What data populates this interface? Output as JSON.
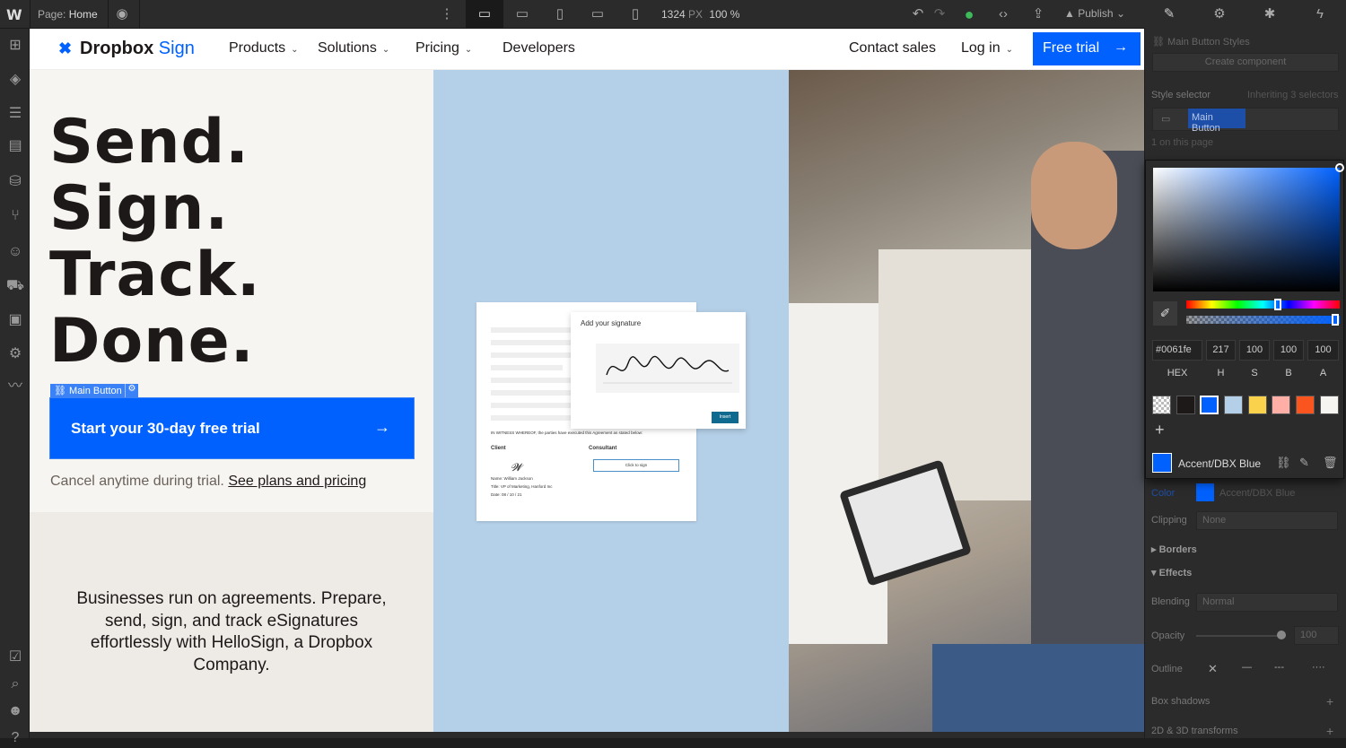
{
  "topbar": {
    "page_prefix": "Page:",
    "page_name": "Home",
    "width_value": "1324",
    "width_unit": "PX",
    "zoom": "100 %",
    "publish_label": "Publish"
  },
  "site": {
    "brand_word": "Dropbox",
    "brand_sign": "Sign",
    "nav": [
      "Products",
      "Solutions",
      "Pricing",
      "Developers"
    ],
    "contact_sales": "Contact sales",
    "log_in": "Log in",
    "free_trial": "Free trial",
    "headline": [
      "Send.",
      "Sign.",
      "Track.",
      "Done."
    ],
    "selected_tag": "Main Button",
    "cta_label": "Start your 30-day free trial",
    "cancel_text": "Cancel anytime during trial.",
    "cancel_link": "See plans and pricing",
    "blurb": "Businesses run on agreements. Prepare, send, sign, and track eSignatures effortlessly with HelloSign, a Dropbox Company.",
    "doc": {
      "modal_title": "Add your signature",
      "insert": "Insert",
      "witness": "IN WITNESS WHEREOF, the parties have executed this Agreement as stated below:",
      "client": "Client",
      "consultant": "Consultant",
      "click_to_sign": "Click to sign",
      "client_name": "Name: William Jackson",
      "client_title": "Title: VP of Marketing, Hanford Inc",
      "client_date": "Date: 08 / 10 / 21"
    }
  },
  "panel": {
    "styles_header": "Main Button Styles",
    "create_component": "Create component",
    "style_selector": "Style selector",
    "inheriting": "Inheriting 3 selectors",
    "selector_chip": "Main Button",
    "on_page": "1 on this page",
    "color_label": "Color",
    "color_value": "Accent/DBX Blue",
    "clipping_label": "Clipping",
    "clipping_value": "None",
    "borders": "Borders",
    "effects": "Effects",
    "blending_label": "Blending",
    "blending_value": "Normal",
    "opacity_label": "Opacity",
    "opacity_value": "100",
    "outline_label": "Outline",
    "box_shadows": "Box shadows",
    "transforms": "2D & 3D transforms"
  },
  "picker": {
    "hex": "#0061fe",
    "h": "217",
    "s": "100",
    "b": "100",
    "a": "100",
    "labels": [
      "HEX",
      "H",
      "S",
      "B",
      "A"
    ],
    "swatch_name": "Accent/DBX Blue",
    "swatches": [
      "transparent",
      "#1e1919",
      "#0061fe",
      "#b4d0e8",
      "#fad24b",
      "#ffafa5",
      "#fa551e",
      "#f7f5f2"
    ]
  },
  "colors": {
    "accent": "#0061fe",
    "chrome": "#2b2b2b"
  }
}
